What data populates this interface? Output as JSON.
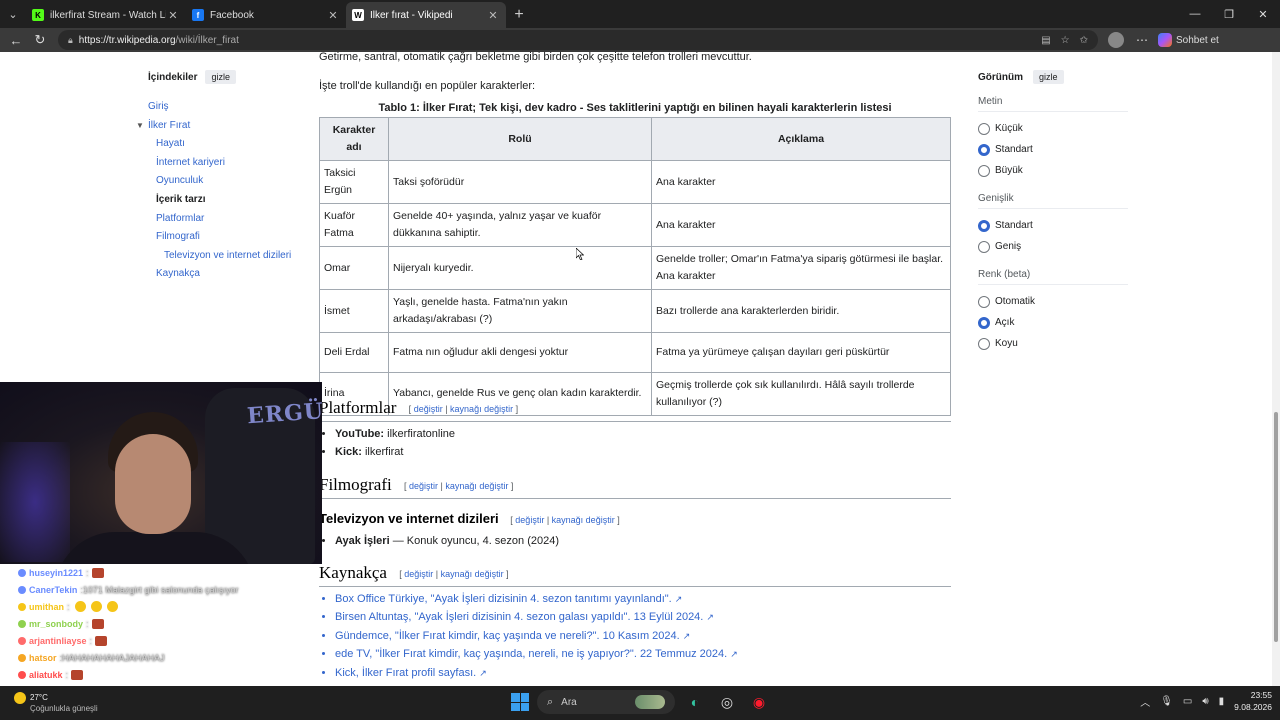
{
  "browser": {
    "tabs": [
      {
        "title": "ilkerfirat Stream - Watch Live on K",
        "favicon": "K",
        "favicon_color": "#53fc18",
        "active": false
      },
      {
        "title": "Facebook",
        "favicon": "f",
        "favicon_color": "#1877f2",
        "active": false
      },
      {
        "title": "İlker fırat - Vikipedi",
        "favicon": "W",
        "favicon_color": "#ffffff",
        "active": true
      }
    ],
    "url_host": "https://tr.wikipedia.org",
    "url_path": "/wiki/İlker_firat",
    "copilot_label": "Sohbet et"
  },
  "toc": {
    "heading": "İçindekiler",
    "hide_label": "gizle",
    "items": [
      {
        "label": "Giriş",
        "level": 0
      },
      {
        "label": "İlker Fırat",
        "level": 0
      },
      {
        "label": "Hayatı",
        "level": 1
      },
      {
        "label": "İnternet kariyeri",
        "level": 1
      },
      {
        "label": "Oyunculuk",
        "level": 1
      },
      {
        "label": "İçerik tarzı",
        "level": 1
      },
      {
        "label": "Platformlar",
        "level": 1
      },
      {
        "label": "Filmografi",
        "level": 1
      },
      {
        "label": "Televizyon ve internet dizileri",
        "level": 2
      },
      {
        "label": "Kaynakça",
        "level": 1
      }
    ]
  },
  "appearance": {
    "heading": "Görünüm",
    "hide_label": "gizle",
    "groups": [
      {
        "label": "Metin",
        "options": [
          "Küçük",
          "Standart",
          "Büyük"
        ],
        "selected": 1
      },
      {
        "label": "Genişlik",
        "options": [
          "Standart",
          "Geniş"
        ],
        "selected": 0
      },
      {
        "label": "Renk (beta)",
        "options": [
          "Otomatik",
          "Açık",
          "Koyu"
        ],
        "selected": 1
      }
    ]
  },
  "article": {
    "intro1": "Getirme, santral, otomatik çağrı bekletme gibi birden çok çeşitte telefon trolleri mevcuttur.",
    "intro2": "İşte troll'de kullandığı en popüler karakterler:",
    "table_caption": "Tablo 1: İlker Fırat; Tek kişi, dev kadro - Ses taklitlerini yaptığı en bilinen hayali karakterlerin listesi",
    "table_headers": [
      "Karakter adı",
      "Rolü",
      "Açıklama"
    ],
    "table_rows": [
      [
        "Taksici Ergün",
        "Taksi şoförüdür",
        "Ana karakter"
      ],
      [
        "Kuaför Fatma",
        "Genelde 40+ yaşında, yalnız yaşar ve kuaför dükkanına sahiptir.",
        "Ana karakter"
      ],
      [
        "Omar",
        "Nijeryalı kuryedir.",
        "Genelde troller; Omar'ın Fatma'ya sipariş götürmesi ile başlar. Ana karakter"
      ],
      [
        "İsmet",
        "Yaşlı, genelde hasta. Fatma'nın yakın arkadaşı/akrabası (?)",
        "Bazı trollerde ana karakterlerden biridir."
      ],
      [
        "Deli Erdal",
        "Fatma nın oğludur akli dengesi yoktur",
        "Fatma ya yürümeye çalışan dayıları geri püskürtür"
      ],
      [
        "İrina",
        "Yabancı, genelde Rus ve genç olan kadın karakterdir.",
        "Geçmiş trollerde çok sık kullanılırdı. Hâlâ sayılı trollerde kullanılıyor (?)"
      ]
    ],
    "edit_label": "değiştir",
    "edit_source_label": "kaynağı değiştir",
    "platforms_heading": "Platformlar",
    "platforms": [
      {
        "name": "YouTube:",
        "value": "ilkerfiratonline"
      },
      {
        "name": "Kick:",
        "value": "ilkerfirat"
      }
    ],
    "filmography_heading": "Filmografi",
    "tv_heading": "Televizyon ve internet dizileri",
    "tv_items": [
      {
        "title": "Ayak İşleri",
        "detail": " — Konuk oyuncu, 4. sezon (2024)"
      }
    ],
    "references_heading": "Kaynakça",
    "references": [
      "Box Office Türkiye, \"Ayak İşleri dizisinin 4. sezon tanıtımı yayınlandı\".",
      "Birsen Altuntaş, \"Ayak İşleri dizisinin 4. sezon galası yapıldı\". 13 Eylül 2024.",
      "Gündemce, \"İlker Fırat kimdir, kaç yaşında ve nereli?\". 10 Kasım 2024.",
      "ede TV, \"İlker Fırat kimdir, kaç yaşında, nereli, ne iş yapıyor?\". 22 Temmuz 2024.",
      "Kick, İlker Fırat profil sayfası."
    ]
  },
  "webcam": {
    "chair_text": "ERGÜN"
  },
  "chat": [
    {
      "user": "huseyin1221",
      "color": "#6a8cff",
      "msg": "",
      "emotes": 1
    },
    {
      "user": "CanerTekin",
      "color": "#6a8cff",
      "msg": "1071 Malazgirt gibi salonunda çalışıyor",
      "emotes": 0
    },
    {
      "user": "umithan",
      "color": "#f5c518",
      "msg": "",
      "emotes": 3
    },
    {
      "user": "mr_sonbody",
      "color": "#8fd14f",
      "msg": "",
      "emotes": 1
    },
    {
      "user": "arjantinliayse",
      "color": "#ff6b6b",
      "msg": "",
      "emotes": 1
    },
    {
      "user": "hatsor",
      "color": "#f5a623",
      "msg": "HAHAHAHAHAJAHAHAJ",
      "emotes": 0
    },
    {
      "user": "aliatukk",
      "color": "#ff4d4d",
      "msg": "",
      "emotes": 1
    },
    {
      "user": "Texaco",
      "color": "#ff4d4d",
      "msg": "serkan nerde",
      "emotes": 0
    }
  ],
  "taskbar": {
    "weather": "27°C",
    "weather_desc": "Çoğunlukla güneşli",
    "search_placeholder": "Ara",
    "time": "23:55",
    "date": "9.08.2026"
  }
}
